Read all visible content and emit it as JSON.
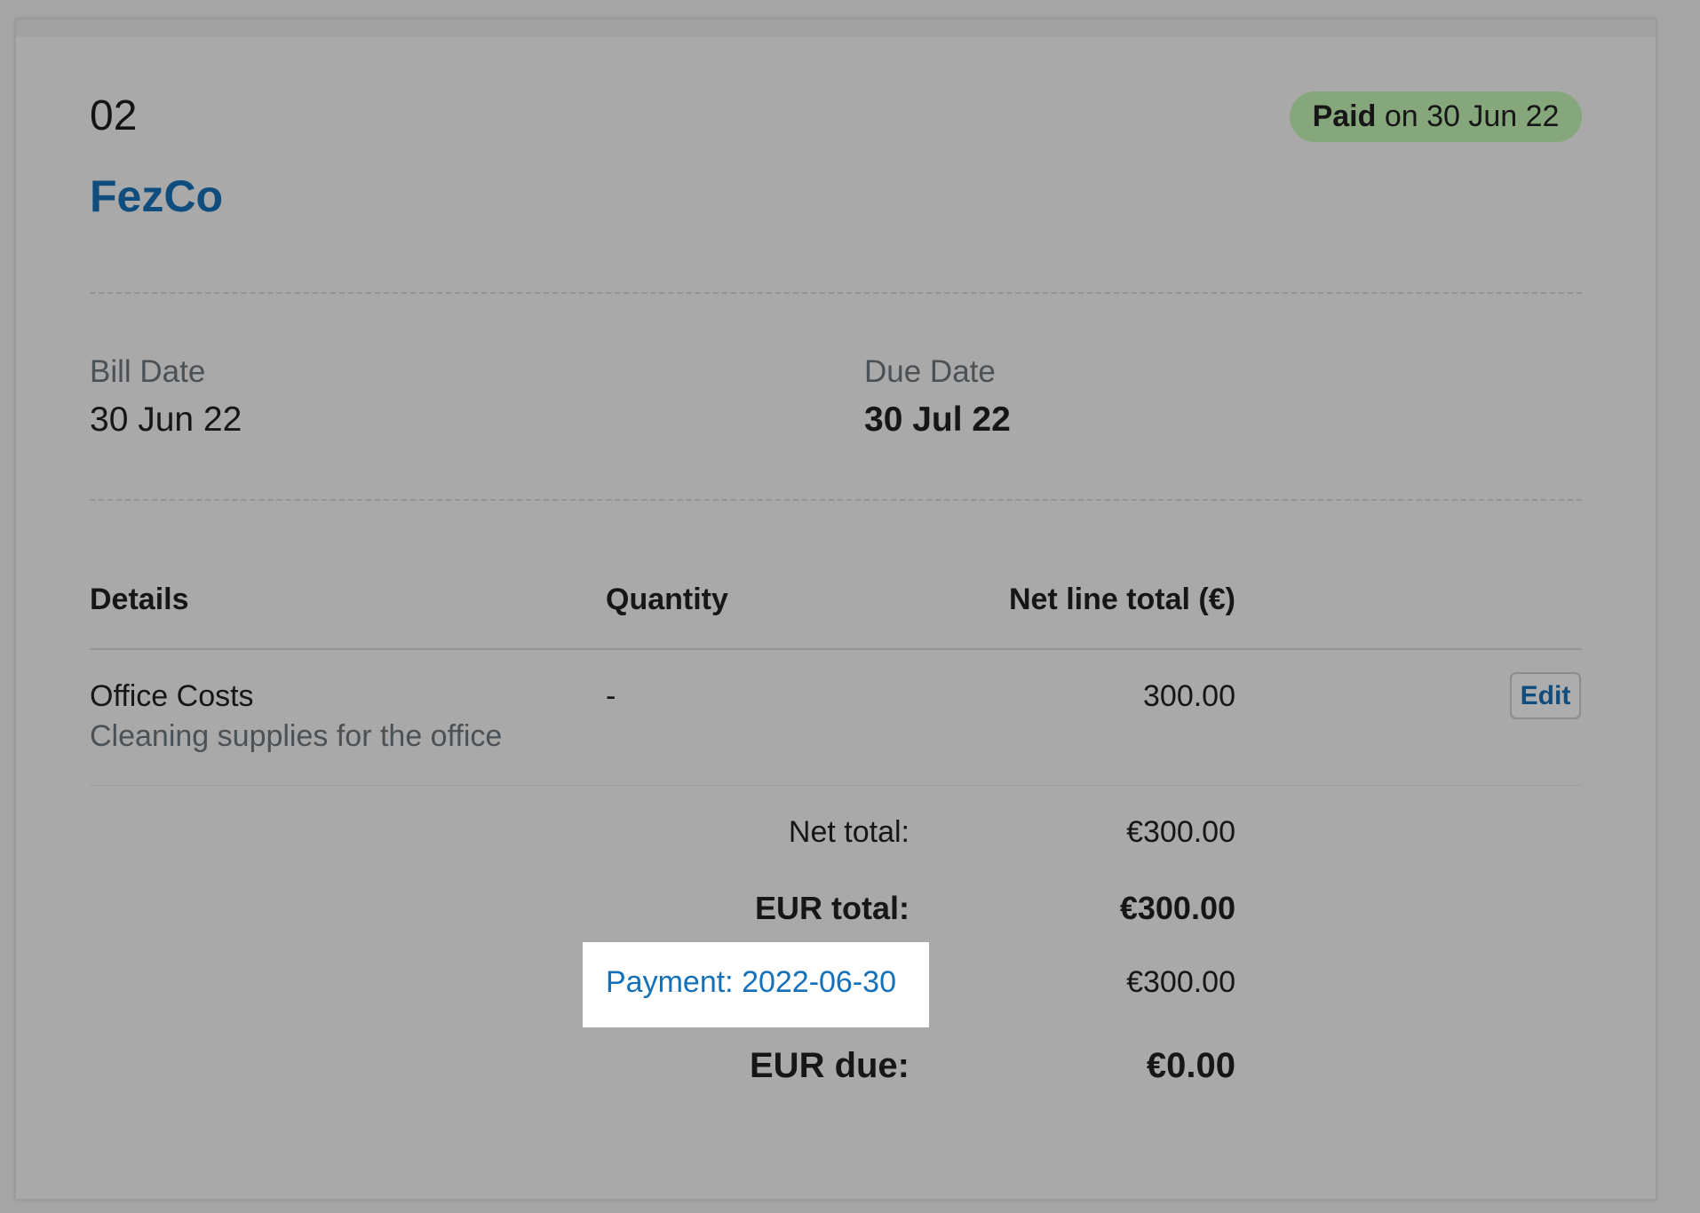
{
  "bill": {
    "number": "02",
    "supplier": "FezCo",
    "status_strong": "Paid",
    "status_rest": " on 30 Jun 22"
  },
  "dates": {
    "bill_date_label": "Bill Date",
    "bill_date_value": "30 Jun 22",
    "due_date_label": "Due Date",
    "due_date_value": "30 Jul 22"
  },
  "table": {
    "headers": {
      "details": "Details",
      "quantity": "Quantity",
      "net_line_total": "Net line total (€)"
    },
    "rows": [
      {
        "title": "Office Costs",
        "description": "Cleaning supplies for the office",
        "quantity": "-",
        "net_line_total": "300.00",
        "action_label": "Edit"
      }
    ]
  },
  "totals": {
    "net_total_label": "Net total:",
    "net_total_value": "€300.00",
    "eur_total_label": "EUR total:",
    "eur_total_value": "€300.00",
    "payment_label": "Payment: 2022-06-30",
    "payment_value": "€300.00",
    "eur_due_label": "EUR due:",
    "eur_due_value": "€0.00"
  },
  "colors": {
    "link": "#0e4d7d",
    "payment_link": "#1470b8",
    "paid_badge": "#86a77b",
    "highlight_box": "#ffffff"
  }
}
